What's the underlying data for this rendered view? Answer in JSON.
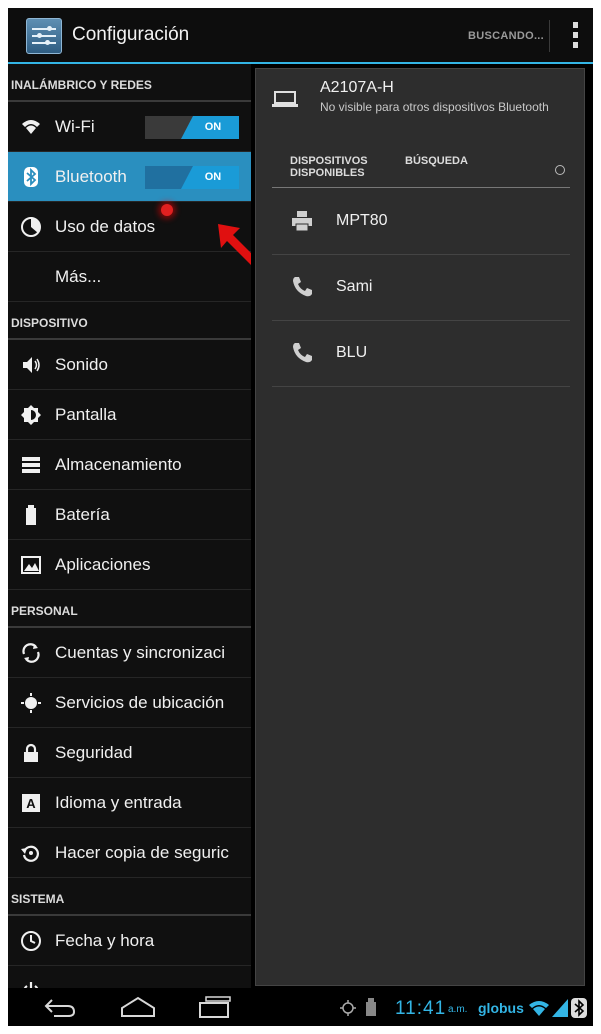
{
  "action_bar": {
    "title": "Configuración",
    "status": "BUSCANDO..."
  },
  "settings": {
    "sections": [
      {
        "header": "INALÁMBRICO Y REDES",
        "items": [
          {
            "label": "Wi-Fi",
            "icon": "wifi-icon",
            "toggle": "ON"
          },
          {
            "label": "Bluetooth",
            "icon": "bluetooth-icon",
            "toggle": "ON",
            "selected": true
          },
          {
            "label": "Uso de datos",
            "icon": "data-usage-icon"
          },
          {
            "label": "Más...",
            "icon": ""
          }
        ]
      },
      {
        "header": "DISPOSITIVO",
        "items": [
          {
            "label": "Sonido",
            "icon": "sound-icon"
          },
          {
            "label": "Pantalla",
            "icon": "display-icon"
          },
          {
            "label": "Almacenamiento",
            "icon": "storage-icon"
          },
          {
            "label": "Batería",
            "icon": "battery-icon"
          },
          {
            "label": "Aplicaciones",
            "icon": "apps-icon"
          }
        ]
      },
      {
        "header": "PERSONAL",
        "items": [
          {
            "label": "Cuentas y sincronizaci",
            "icon": "sync-icon"
          },
          {
            "label": "Servicios de ubicación",
            "icon": "location-icon"
          },
          {
            "label": "Seguridad",
            "icon": "lock-icon"
          },
          {
            "label": "Idioma y entrada",
            "icon": "language-icon"
          },
          {
            "label": "Hacer copia de seguric",
            "icon": "backup-icon"
          }
        ]
      },
      {
        "header": "SISTEMA",
        "items": [
          {
            "label": "Fecha y hora",
            "icon": "clock-icon"
          }
        ]
      }
    ]
  },
  "bluetooth": {
    "device_name": "A2107A-H",
    "device_visibility": "No visible para otros dispositivos Bluetooth",
    "tab_available": "DISPOSITIVOS DISPONIBLES",
    "tab_search": "BÚSQUEDA",
    "devices": [
      {
        "name": "MPT80",
        "icon": "printer-icon"
      },
      {
        "name": "Sami",
        "icon": "phone-icon"
      },
      {
        "name": "BLU",
        "icon": "phone-icon"
      }
    ]
  },
  "status_bar": {
    "time": "11:41",
    "ampm": "a.m.",
    "carrier": "globus"
  },
  "colors": {
    "accent": "#33b5e5",
    "selected_bg": "#2a8fbf",
    "toggle_on": "#1a9bd7"
  }
}
